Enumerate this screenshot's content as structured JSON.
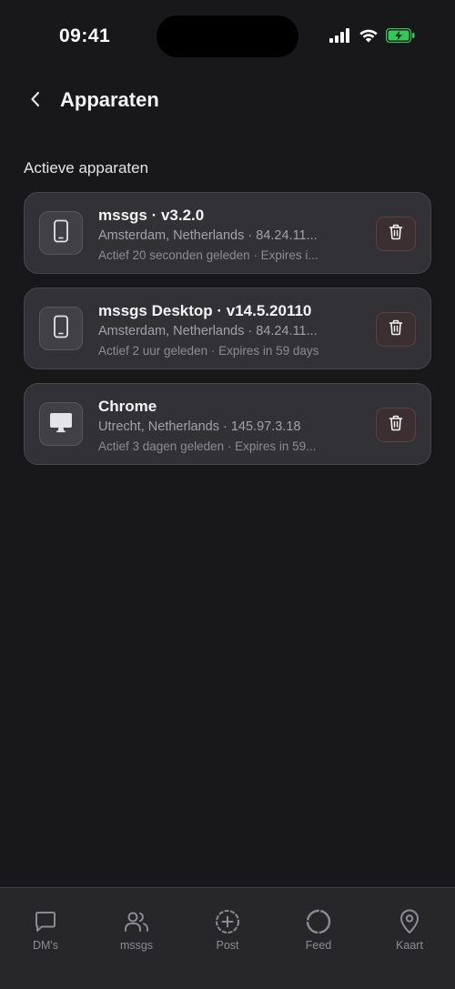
{
  "status_bar": {
    "time": "09:41",
    "icons": [
      "signal-icon",
      "wifi-icon",
      "battery-charging-icon"
    ],
    "battery_color": "#34c759"
  },
  "header": {
    "back_icon": "chevron-left-icon",
    "title": "Apparaten"
  },
  "section": {
    "title": "Actieve apparaten"
  },
  "devices": [
    {
      "icon": "phone-icon",
      "name": "mssgs · v3.2.0",
      "location": "Amsterdam, Netherlands · 84.24.11...",
      "activity": "Actief 20 seconden geleden · Expires i...",
      "delete_icon": "trash-icon"
    },
    {
      "icon": "phone-icon",
      "name": "mssgs Desktop · v14.5.20110",
      "location": "Amsterdam, Netherlands · 84.24.11...",
      "activity": "Actief 2 uur geleden · Expires in 59 days",
      "delete_icon": "trash-icon"
    },
    {
      "icon": "monitor-icon",
      "name": "Chrome",
      "location": "Utrecht, Netherlands · 145.97.3.18",
      "activity": "Actief 3 dagen geleden · Expires in 59...",
      "delete_icon": "trash-icon"
    }
  ],
  "tabs": [
    {
      "label": "DM's",
      "icon": "chat-bubble-icon"
    },
    {
      "label": "mssgs",
      "icon": "users-icon"
    },
    {
      "label": "Post",
      "icon": "plus-circle-icon"
    },
    {
      "label": "Feed",
      "icon": "circle-icon"
    },
    {
      "label": "Kaart",
      "icon": "map-pin-icon"
    }
  ],
  "colors": {
    "background": "#18181b",
    "card": "#323236",
    "tab_bar": "#27272a",
    "delete_button": "#3b2f31"
  }
}
